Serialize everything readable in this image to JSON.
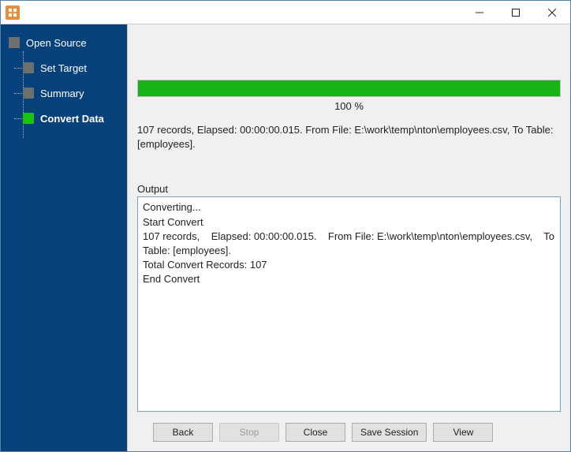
{
  "sidebar": {
    "items": [
      {
        "label": "Open Source"
      },
      {
        "label": "Set Target"
      },
      {
        "label": "Summary"
      },
      {
        "label": "Convert Data"
      }
    ]
  },
  "progress": {
    "percent": 100,
    "label": "100 %"
  },
  "status": "107 records,    Elapsed: 00:00:00.015.    From File: E:\\work\\temp\\nton\\employees.csv,    To Table: [employees].",
  "output": {
    "label": "Output",
    "text": "Converting...\nStart Convert\n107 records,    Elapsed: 00:00:00.015.    From File: E:\\work\\temp\\nton\\employees.csv,    To Table: [employees].\nTotal Convert Records: 107\nEnd Convert\n"
  },
  "buttons": {
    "back": "Back",
    "stop": "Stop",
    "close": "Close",
    "save": "Save Session",
    "view": "View"
  }
}
